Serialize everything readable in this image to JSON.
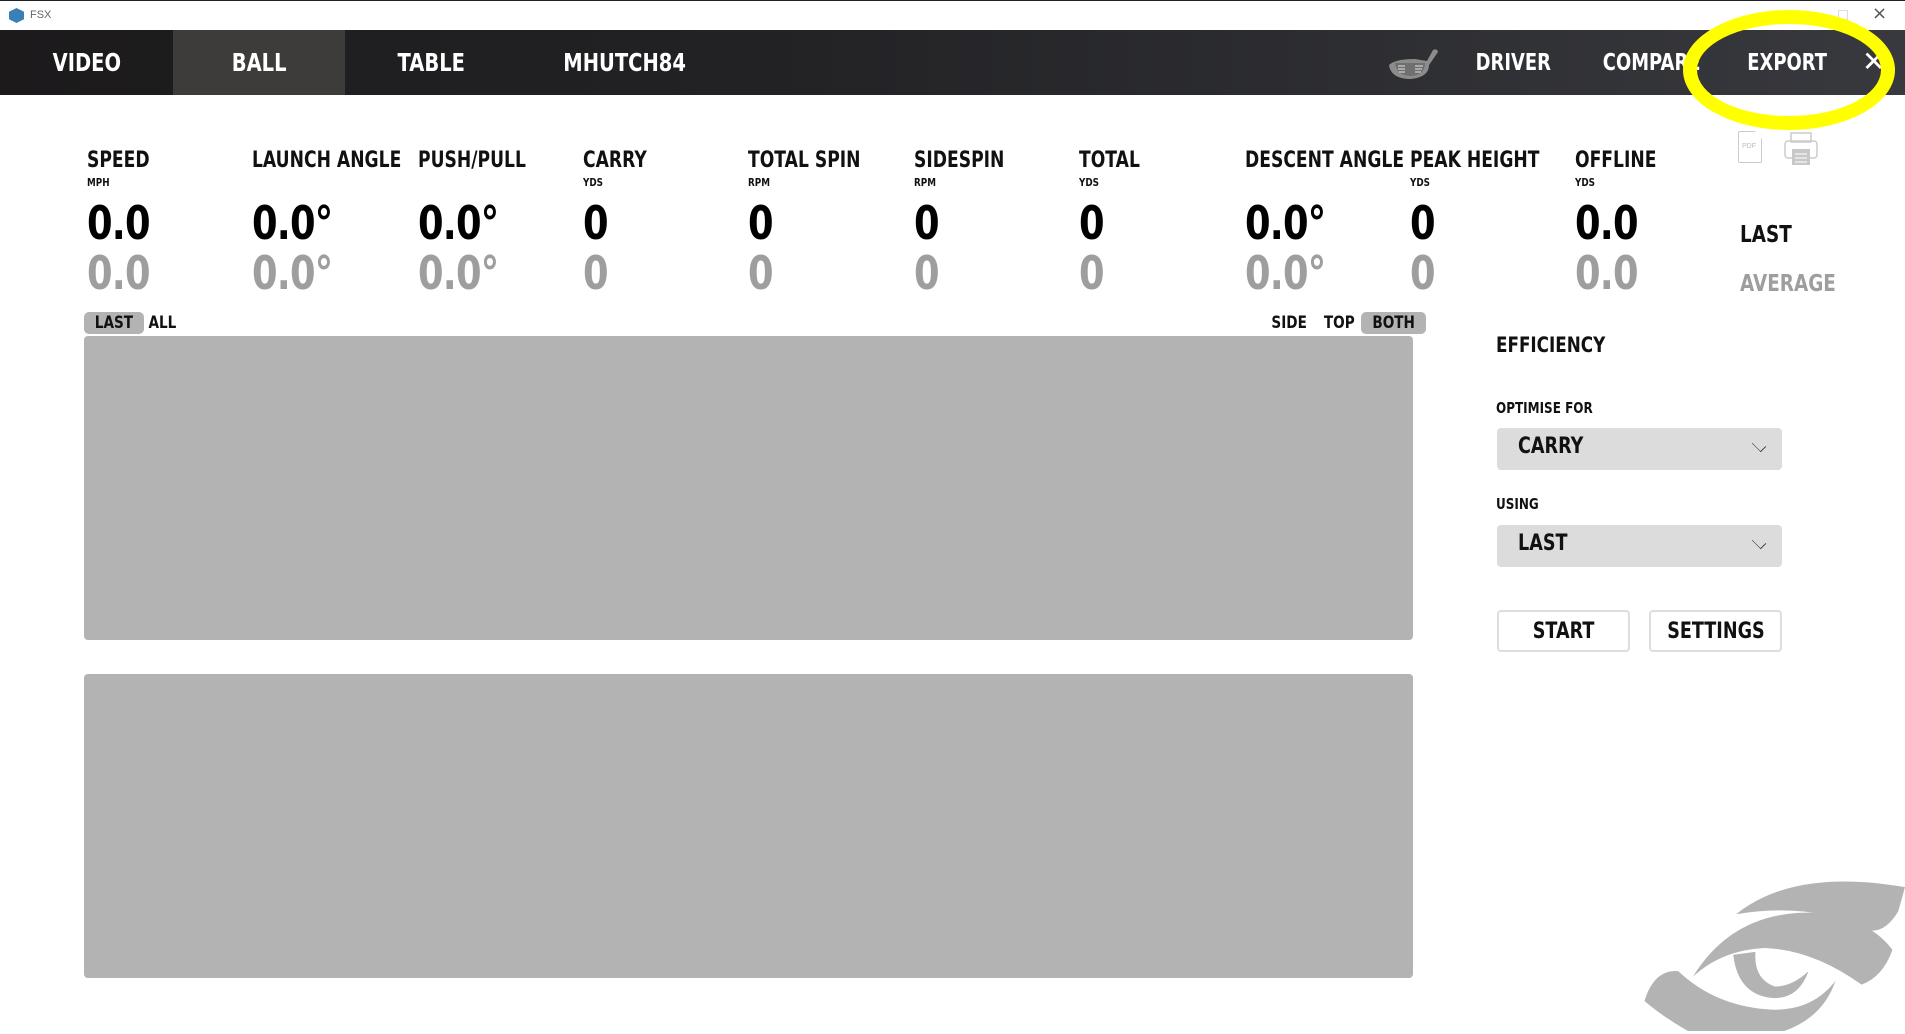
{
  "window": {
    "title": "FSX"
  },
  "nav": {
    "tabs": [
      {
        "label": "VIDEO",
        "active": false
      },
      {
        "label": "BALL",
        "active": true
      },
      {
        "label": "TABLE",
        "active": false
      },
      {
        "label": "MHUTCH84",
        "active": false
      }
    ],
    "club_label": "DRIVER",
    "compare_label": "COMPARE",
    "export_label": "EXPORT",
    "club_icon": "driver-club-icon",
    "close_icon": "close-icon"
  },
  "stats": [
    {
      "label": "SPEED",
      "unit": "MPH",
      "last": "0.0",
      "average": "0.0"
    },
    {
      "label": "LAUNCH ANGLE",
      "unit": "",
      "last": "0.0°",
      "average": "0.0°"
    },
    {
      "label": "PUSH/PULL",
      "unit": "",
      "last": "0.0°",
      "average": "0.0°"
    },
    {
      "label": "CARRY",
      "unit": "YDS",
      "last": "0",
      "average": "0"
    },
    {
      "label": "TOTAL SPIN",
      "unit": "RPM",
      "last": "0",
      "average": "0"
    },
    {
      "label": "SIDESPIN",
      "unit": "RPM",
      "last": "0",
      "average": "0"
    },
    {
      "label": "TOTAL",
      "unit": "YDS",
      "last": "0",
      "average": "0"
    },
    {
      "label": "DESCENT ANGLE",
      "unit": "",
      "last": "0.0°",
      "average": "0.0°"
    },
    {
      "label": "PEAK HEIGHT",
      "unit": "YDS",
      "last": "0",
      "average": "0"
    },
    {
      "label": "OFFLINE",
      "unit": "YDS",
      "last": "0.0",
      "average": "0.0"
    }
  ],
  "row_labels": {
    "last": "LAST",
    "average": "AVERAGE"
  },
  "export_icons": {
    "pdf": "PDF"
  },
  "shot_toggle": {
    "options": [
      "LAST",
      "ALL"
    ],
    "selected": "LAST"
  },
  "view_toggle": {
    "options": [
      "SIDE",
      "TOP",
      "BOTH"
    ],
    "selected": "BOTH"
  },
  "efficiency": {
    "title": "EFFICIENCY",
    "optimise_label": "OPTIMISE FOR",
    "optimise_value": "CARRY",
    "using_label": "USING",
    "using_value": "LAST",
    "start_label": "START",
    "settings_label": "SETTINGS"
  },
  "colors": {
    "annotation": "#ffff00",
    "panel": "#b3b3b3",
    "average_text": "#9e9e9e"
  }
}
